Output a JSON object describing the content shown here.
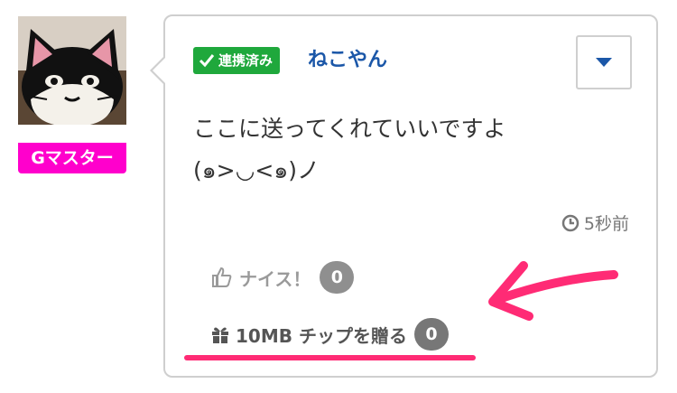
{
  "profile": {
    "avatar_icon": "cat-face-avatar",
    "rank_label": "Gマスター",
    "rank_color": "#ff00cc"
  },
  "post": {
    "linked_label": "連携済み",
    "linked_color": "#1fa83c",
    "username": "ねこやん",
    "message_lines": [
      "ここに送ってくれていいですよ",
      "(๑>◡<๑)ノ"
    ],
    "timestamp": "5秒前",
    "menu_icon": "caret-down-icon",
    "nice": {
      "label": "ナイス！",
      "count": "0",
      "icon": "thumbs-up-icon"
    },
    "tip": {
      "label": "10MB チップを贈る",
      "count": "0",
      "icon": "gift-icon"
    }
  },
  "annotation": {
    "color": "#ff2b75",
    "marks": [
      "underline-tip",
      "arrow-pointing-to-tip"
    ]
  }
}
